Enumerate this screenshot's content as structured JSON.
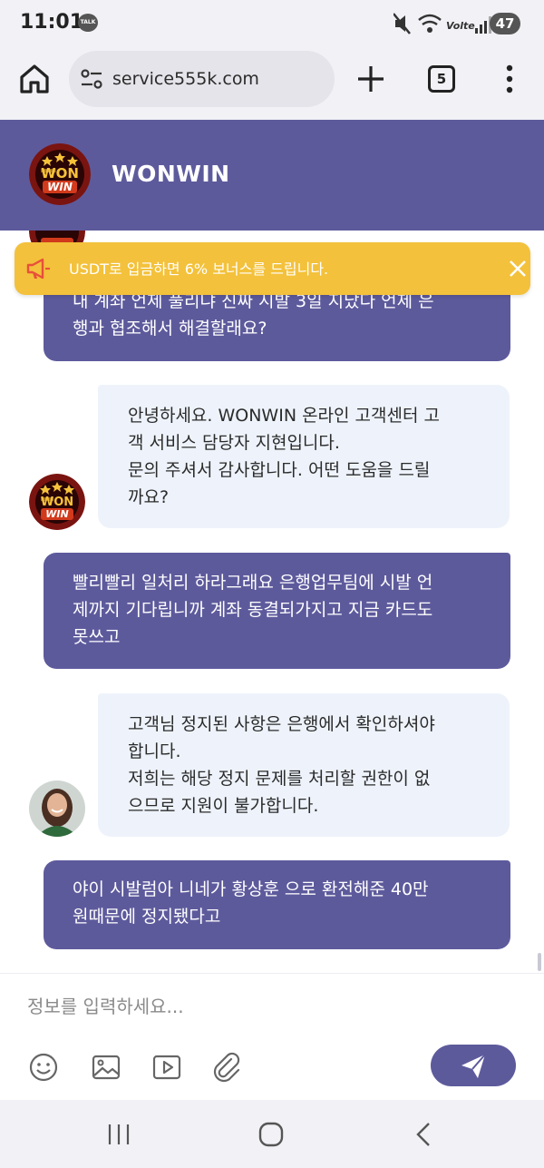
{
  "status_bar": {
    "time": "11:01",
    "talk_badge": "TALK",
    "battery": "47",
    "icons": [
      "mute-icon",
      "wifi-icon",
      "volte-icon",
      "signal-icon"
    ]
  },
  "browser": {
    "url": "service555k.com",
    "tab_count": "5",
    "icons": [
      "home-icon",
      "site-settings-icon",
      "new-tab-icon",
      "tabs-icon",
      "more-menu-icon"
    ]
  },
  "header": {
    "title": "WONWIN",
    "logo_text_1": "₩ON",
    "logo_text_2": "WIN"
  },
  "notice": {
    "text": "USDT로 입금하면 6% 보너스를 드립니다."
  },
  "messages": [
    {
      "sender": "user",
      "lines": [
        "내 계좌 언제 풀리냐 진짜 시발 3일 지났다 언제 은",
        "행과 협조해서 해결할래요?"
      ]
    },
    {
      "sender": "agent",
      "avatar": "logo",
      "lines": [
        "안녕하세요. WONWIN 온라인 고객센터 고",
        "객 서비스 담당자 지현입니다.",
        "문의 주셔서 감사합니다. 어떤 도움을 드릴",
        "까요?"
      ]
    },
    {
      "sender": "user",
      "lines": [
        "빨리빨리 일처리 하라그래요 은행업무팀에 시발 언",
        "제까지 기다립니까 계좌 동결되가지고 지금 카드도",
        "못쓰고"
      ]
    },
    {
      "sender": "agent",
      "avatar": "person",
      "lines": [
        "고객님 정지된 사항은 은행에서 확인하셔야",
        "합니다.",
        "저희는 해당 정지 문제를 처리할 권한이 없",
        "으므로 지원이 불가합니다."
      ]
    },
    {
      "sender": "user",
      "lines": [
        "야이 시발럼아 니네가 황상훈 으로 환전해준 40만",
        "원때문에 정지됐다고"
      ]
    }
  ],
  "input": {
    "placeholder": "정보를 입력하세요...",
    "tools": [
      "emoji-icon",
      "image-icon",
      "video-icon",
      "attach-icon"
    ],
    "send_icon": "send-icon"
  },
  "colors": {
    "brand": "#5d5a9c",
    "notice": "#f3c13b",
    "agent_bubble": "#eef3fb",
    "user_text": "#ffffff"
  }
}
